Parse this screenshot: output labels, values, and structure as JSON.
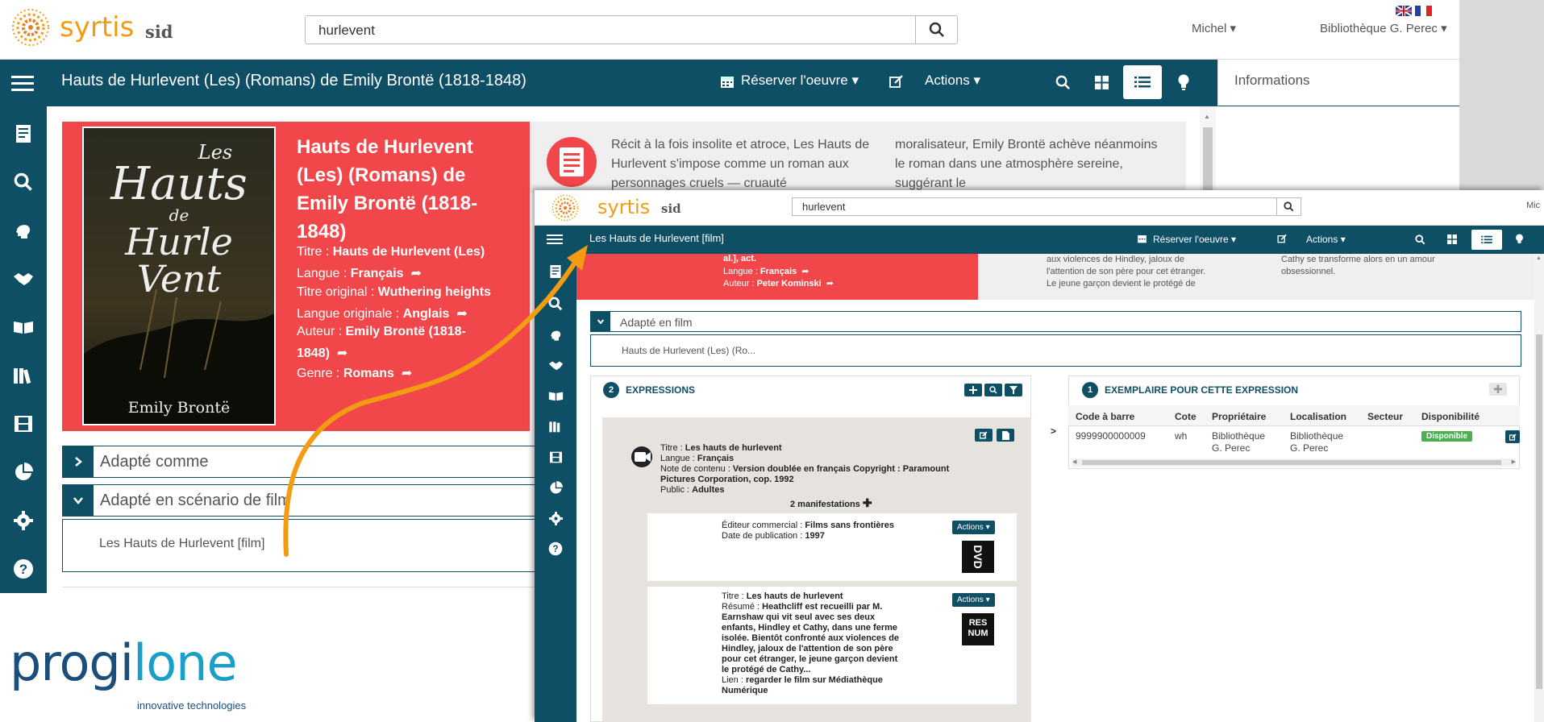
{
  "back": {
    "brand": {
      "name": "syrtis",
      "suffix": "sid"
    },
    "search": {
      "value": "hurlevent"
    },
    "user": {
      "name": "Michel",
      "library": "Bibliothèque G. Perec"
    },
    "titlebar": {
      "title": "Hauts de Hurlevent (Les) (Romans) de Emily Brontë (1818-1848)",
      "reserve_label": "Réserver l'oeuvre",
      "actions_label": "Actions"
    },
    "info_label": "Informations",
    "notice": {
      "cover_title_lines": [
        "Les",
        "Hauts",
        "de",
        "Hurle Vent"
      ],
      "cover_author": "Emily Brontë",
      "title": "Hauts de Hurlevent (Les) (Romans) de Emily Brontë (1818-1848)",
      "fields": [
        {
          "label": "Titre : ",
          "value": "Hauts de Hurlevent (Les)"
        },
        {
          "label": "Langue : ",
          "value": "Français"
        },
        {
          "label": "Titre original : ",
          "value": "Wuthering heights"
        },
        {
          "label": "Langue originale : ",
          "value": "Anglais"
        },
        {
          "label": "Auteur : ",
          "value": "Emily Brontë (1818-"
        },
        {
          "label": "",
          "value": "1848)"
        },
        {
          "label": "Genre : ",
          "value": "Romans"
        }
      ]
    },
    "description": {
      "col1": "Récit à la fois insolite et atroce, Les Hauts de Hurlevent s'impose comme un roman aux personnages cruels — cruauté",
      "col2": "moralisateur, Emily Brontë achève néanmoins le roman dans une atmosphère sereine, suggérant le"
    },
    "accordions": [
      {
        "label": "Adapté comme"
      },
      {
        "label": "Adapté en scénario de film"
      }
    ],
    "adapted_item": "Les Hauts de Hurlevent [film]",
    "logo": {
      "brand_a": "progi",
      "brand_b": "lone",
      "tagline": "innovative technologies"
    }
  },
  "front": {
    "brand": {
      "name": "syrtis",
      "suffix": "sid"
    },
    "search": {
      "value": "hurlevent"
    },
    "user_clip": "Mic",
    "titlebar": {
      "title": "Les Hauts de Hurlevent [film]",
      "reserve_label": "Réserver l'oeuvre",
      "actions_label": "Actions"
    },
    "red_notice": {
      "line0": "al.], act.",
      "langue_label": "Langue : ",
      "langue_value": "Français",
      "auteur_label": "Auteur : ",
      "auteur_value": "Peter Kominski"
    },
    "desc_col1": [
      "aux violences de Hindley, jaloux de",
      "l'attention de son père pour cet étranger.",
      "Le jeune garçon devient le protégé de"
    ],
    "desc_col2": [
      "Cathy se transforme alors en un amour",
      "obsessionnel."
    ],
    "accordion": {
      "label": "Adapté en film",
      "item": "Hauts de Hurlevent (Les) (Ro..."
    },
    "expressions": {
      "count": "2",
      "title": "EXPRESSIONS",
      "expression": {
        "titre_label": "Titre : ",
        "titre_value": "Les hauts de hurlevent",
        "langue_label": "Langue : ",
        "langue_value": "Français",
        "note_label": "Note de contenu : ",
        "note_value": "Version doublée en français Copyright : Paramount Pictures Corporation, cop. 1992",
        "public_label": "Public : ",
        "public_value": "Adultes",
        "manifestations": "2 manifestations"
      },
      "manif1": {
        "editeur_label": "Éditeur commercial : ",
        "editeur_value": "Films sans frontières",
        "date_label": "Date de publication : ",
        "date_value": "1997",
        "actions": "Actions",
        "badge": "DVD"
      },
      "manif2": {
        "titre_label": "Titre : ",
        "titre_value": "Les hauts de hurlevent",
        "resume_label": "Résumé : ",
        "resume_lines": [
          "Heathcliff est recueilli par M.",
          "Earnshaw qui vit seul avec ses deux",
          "enfants, Hindley et Cathy, dans une ferme",
          "isolée. Bientôt confronté aux violences de",
          "Hindley, jaloux de l'attention de son père",
          "pour cet étranger, le jeune garçon devient",
          "le protégé de Cathy..."
        ],
        "lien_label": "Lien : ",
        "lien_value": "regarder le film sur Médiathèque Numérique",
        "actions": "Actions",
        "badge_l1": "RES",
        "badge_l2": "NUM"
      }
    },
    "exemplaires": {
      "count": "1",
      "title": "EXEMPLAIRE POUR CETTE EXPRESSION",
      "columns": [
        "Code à barre",
        "Cote",
        "Propriétaire",
        "Localisation",
        "Secteur",
        "Disponibilité"
      ],
      "row": {
        "code": "9999900000009",
        "cote": "wh",
        "proprietaire_l1": "Bibliothèque",
        "proprietaire_l2": "G. Perec",
        "localisation_l1": "Bibliothèque",
        "localisation_l2": "G. Perec",
        "secteur": "",
        "disponibilite": "Disponible"
      }
    }
  },
  "colors": {
    "teal": "#0f4f66",
    "red": "#f2474a",
    "orange": "#f39c12",
    "green": "#4caf50"
  }
}
